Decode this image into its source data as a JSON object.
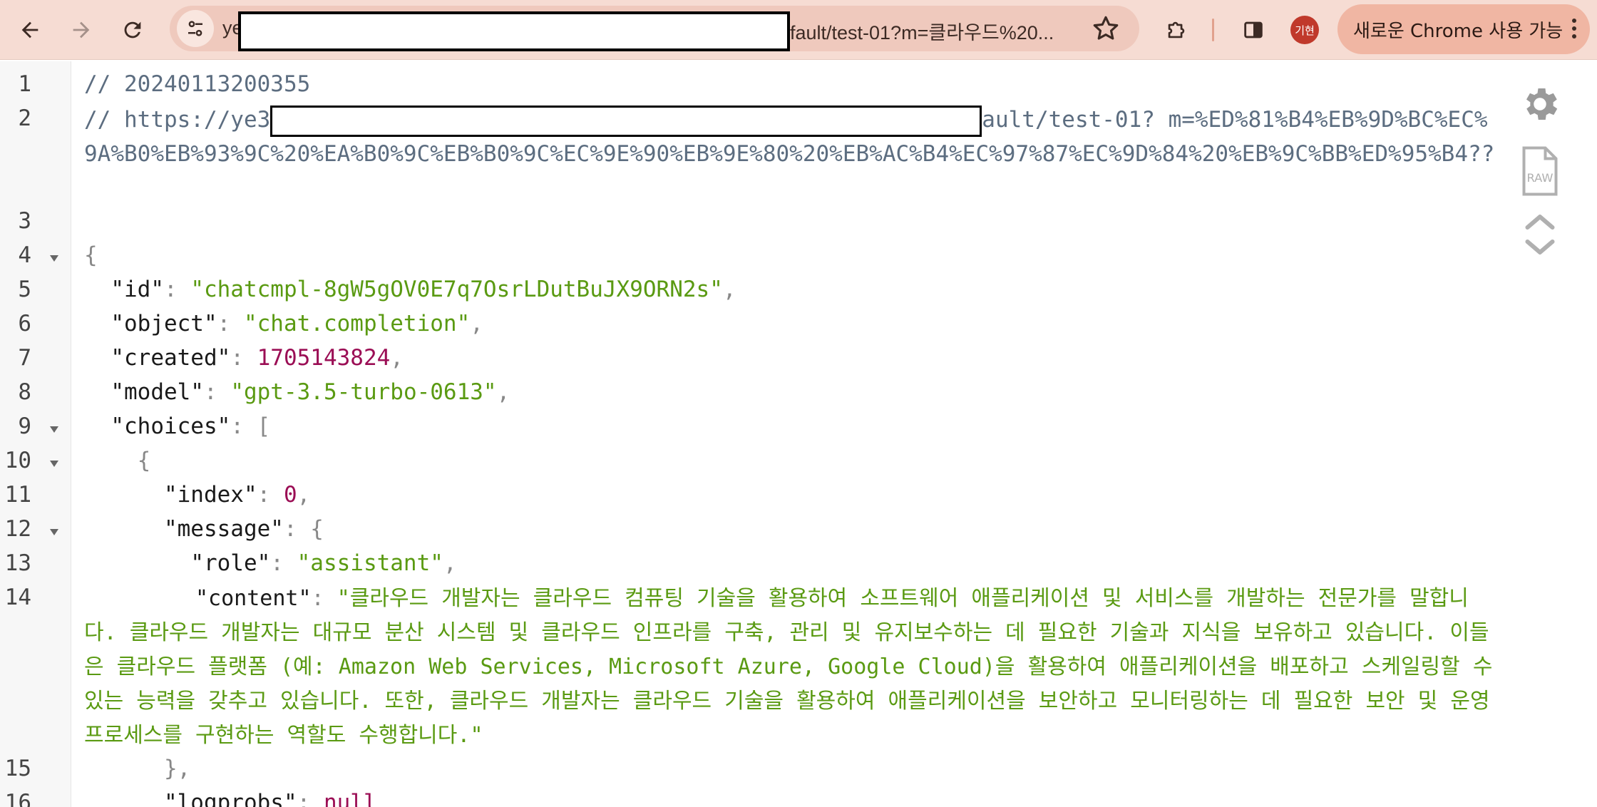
{
  "browser": {
    "url_prefix": "ye",
    "url_suffix": "fault/test-01?m=클라우드%20...",
    "profile_initials": "기현",
    "chrome_update_label": "새로운 Chrome 사용 가능"
  },
  "json_viewer": {
    "line_numbers": [
      "1",
      "2",
      "3",
      "4",
      "5",
      "6",
      "7",
      "8",
      "9",
      "10",
      "11",
      "12",
      "13",
      "14",
      "15",
      "16"
    ],
    "comment_timestamp": "// 20240113200355",
    "comment_url_prefix": "// https://ye3",
    "comment_url_suffix": "ault/test-01?",
    "comment_url_query": "m=%ED%81%B4%EB%9D%BC%EC%9A%B0%EB%93%9C%20%EA%B0%9C%EB%B0%9C%EC%9E%90%EB%9E%80%20%EB%AC%B4%EC%97%87%EC%9D%84%20%EB%9C%BB%ED%95%B4??",
    "open_brace": "{",
    "id_key": "\"id\"",
    "id_value": "\"chatcmpl-8gW5gOV0E7q7OsrLDutBuJX9ORN2s\"",
    "object_key": "\"object\"",
    "object_value": "\"chat.completion\"",
    "created_key": "\"created\"",
    "created_value": "1705143824",
    "model_key": "\"model\"",
    "model_value": "\"gpt-3.5-turbo-0613\"",
    "choices_key": "\"choices\"",
    "index_key": "\"index\"",
    "index_value": "0",
    "message_key": "\"message\"",
    "role_key": "\"role\"",
    "role_value": "\"assistant\"",
    "content_key": "\"content\"",
    "content_value": "\"클라우드 개발자는 클라우드 컴퓨팅 기술을 활용하여 소프트웨어 애플리케이션 및 서비스를 개발하는 전문가를 말합니다. 클라우드 개발자는 대규모 분산 시스템 및 클라우드 인프라를 구축, 관리 및 유지보수하는 데 필요한 기술과 지식을 보유하고 있습니다. 이들은 클라우드 플랫폼 (예: Amazon Web Services, Microsoft Azure, Google Cloud)을 활용하여 애플리케이션을 배포하고 스케일링할 수 있는 능력을 갖추고 있습니다. 또한, 클라우드 개발자는 클라우드 기술을 활용하여 애플리케이션을 보안하고 모니터링하는 데 필요한 보안 및 운영 프로세스를 구현하는 역할도 수행합니다.\"",
    "close_message": "},",
    "logprobs_key": "\"logprobs\"",
    "logprobs_value": "null"
  },
  "icons": {
    "back": "arrow-left-icon",
    "forward": "arrow-right-icon",
    "reload": "reload-icon",
    "site_info": "tune-icon",
    "bookmark": "star-icon",
    "extensions": "puzzle-icon",
    "side_panel": "side-panel-icon",
    "settings": "gear-icon",
    "raw": "raw-file-icon",
    "collapse": "chevrons-icon"
  },
  "colors": {
    "toolbar": "#f6dcd3",
    "string": "#5a9a12",
    "number": "#9b0e55",
    "comment": "#5c6d80"
  }
}
